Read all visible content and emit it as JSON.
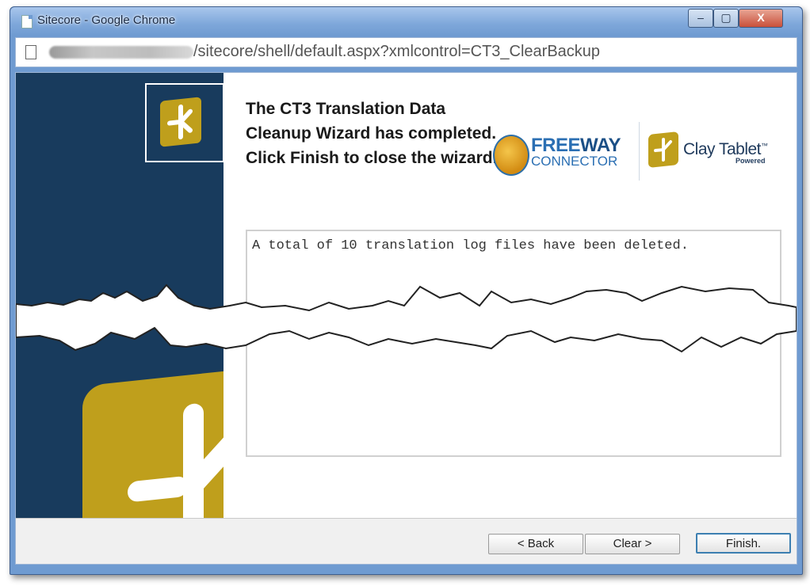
{
  "window": {
    "title": "Sitecore - Google Chrome",
    "controls": {
      "minimize": "–",
      "maximize": "▢",
      "close": "X"
    }
  },
  "address": {
    "url_visible": "/sitecore/shell/default.aspx?xmlcontrol=CT3_ClearBackup"
  },
  "wizard": {
    "heading": "The CT3 Translation Data Cleanup Wizard has completed. Click Finish to close the wizard.",
    "log_text": "A total of 10 translation log files have been deleted."
  },
  "branding": {
    "freeway_name_a": "FREE",
    "freeway_name_b": "WAY",
    "freeway_sub": "CONNECTOR",
    "clay_name": "Clay Tablet",
    "clay_tm": "™",
    "clay_powered": "Powered",
    "colors": {
      "sidebar": "#183b5d",
      "gold": "#bf9f1c",
      "freeway_blue": "#2b6fb3"
    }
  },
  "buttons": {
    "back": "< Back",
    "clear": "Clear >",
    "finish": "Finish."
  }
}
